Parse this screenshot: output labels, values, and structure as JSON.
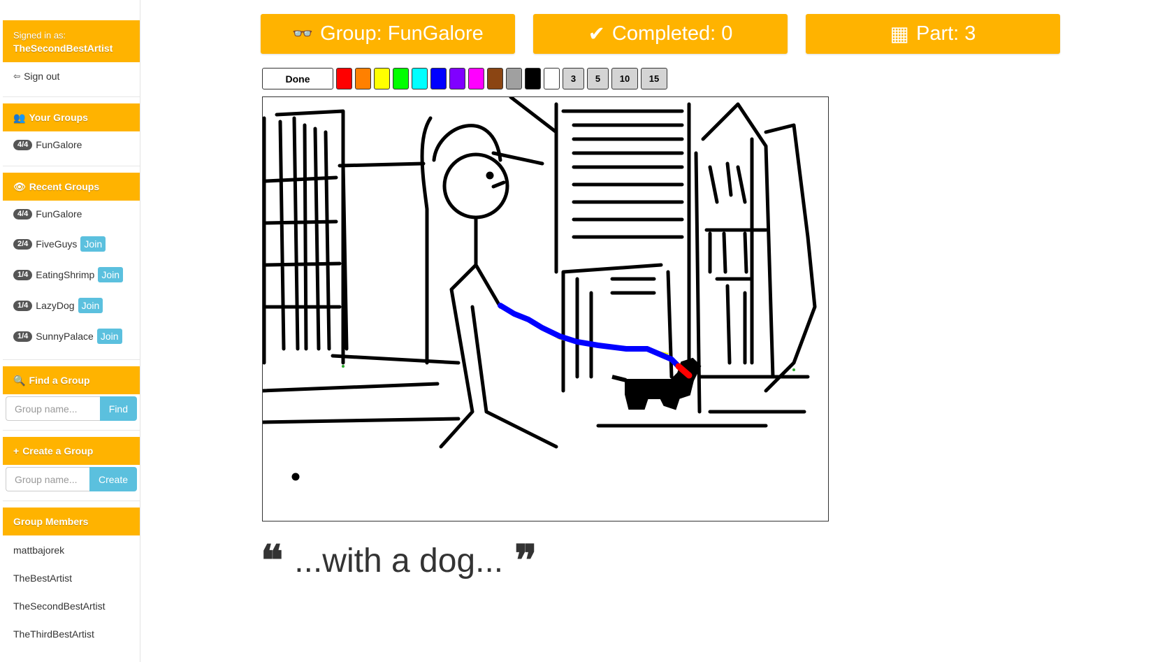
{
  "user": {
    "signed_in_label": "Signed in as:",
    "username": "TheSecondBestArtist",
    "sign_out": "Sign out"
  },
  "your_groups": {
    "title": "Your Groups",
    "items": [
      {
        "badge": "4/4",
        "name": "FunGalore"
      }
    ]
  },
  "recent_groups": {
    "title": "Recent Groups",
    "join_label": "Join",
    "items": [
      {
        "badge": "4/4",
        "name": "FunGalore"
      },
      {
        "badge": "2/4",
        "name": "FiveGuys"
      },
      {
        "badge": "1/4",
        "name": "EatingShrimp"
      },
      {
        "badge": "1/4",
        "name": "LazyDog"
      },
      {
        "badge": "1/4",
        "name": "SunnyPalace"
      }
    ]
  },
  "find_group": {
    "title": "Find a Group",
    "placeholder": "Group name...",
    "button": "Find"
  },
  "create_group": {
    "title": "Create a Group",
    "placeholder": "Group name...",
    "button": "Create"
  },
  "members": {
    "title": "Group Members",
    "items": [
      "mattbajorek",
      "TheBestArtist",
      "TheSecondBestArtist",
      "TheThirdBestArtist"
    ]
  },
  "header": {
    "group": "Group: FunGalore",
    "completed": "Completed: 0",
    "part": "Part: 3"
  },
  "palette": {
    "done": "Done",
    "colors": [
      "#ff0000",
      "#ff8000",
      "#ffff00",
      "#00ff00",
      "#00ffff",
      "#0000ff",
      "#8000ff",
      "#ff00ff",
      "#8b4513",
      "#a0a0a0",
      "#000000",
      "#ffffff"
    ],
    "sizes": [
      "3",
      "5",
      "10",
      "15"
    ]
  },
  "prompt": "...with a dog...",
  "accent": "#ffb300",
  "info": "#5bc0de"
}
